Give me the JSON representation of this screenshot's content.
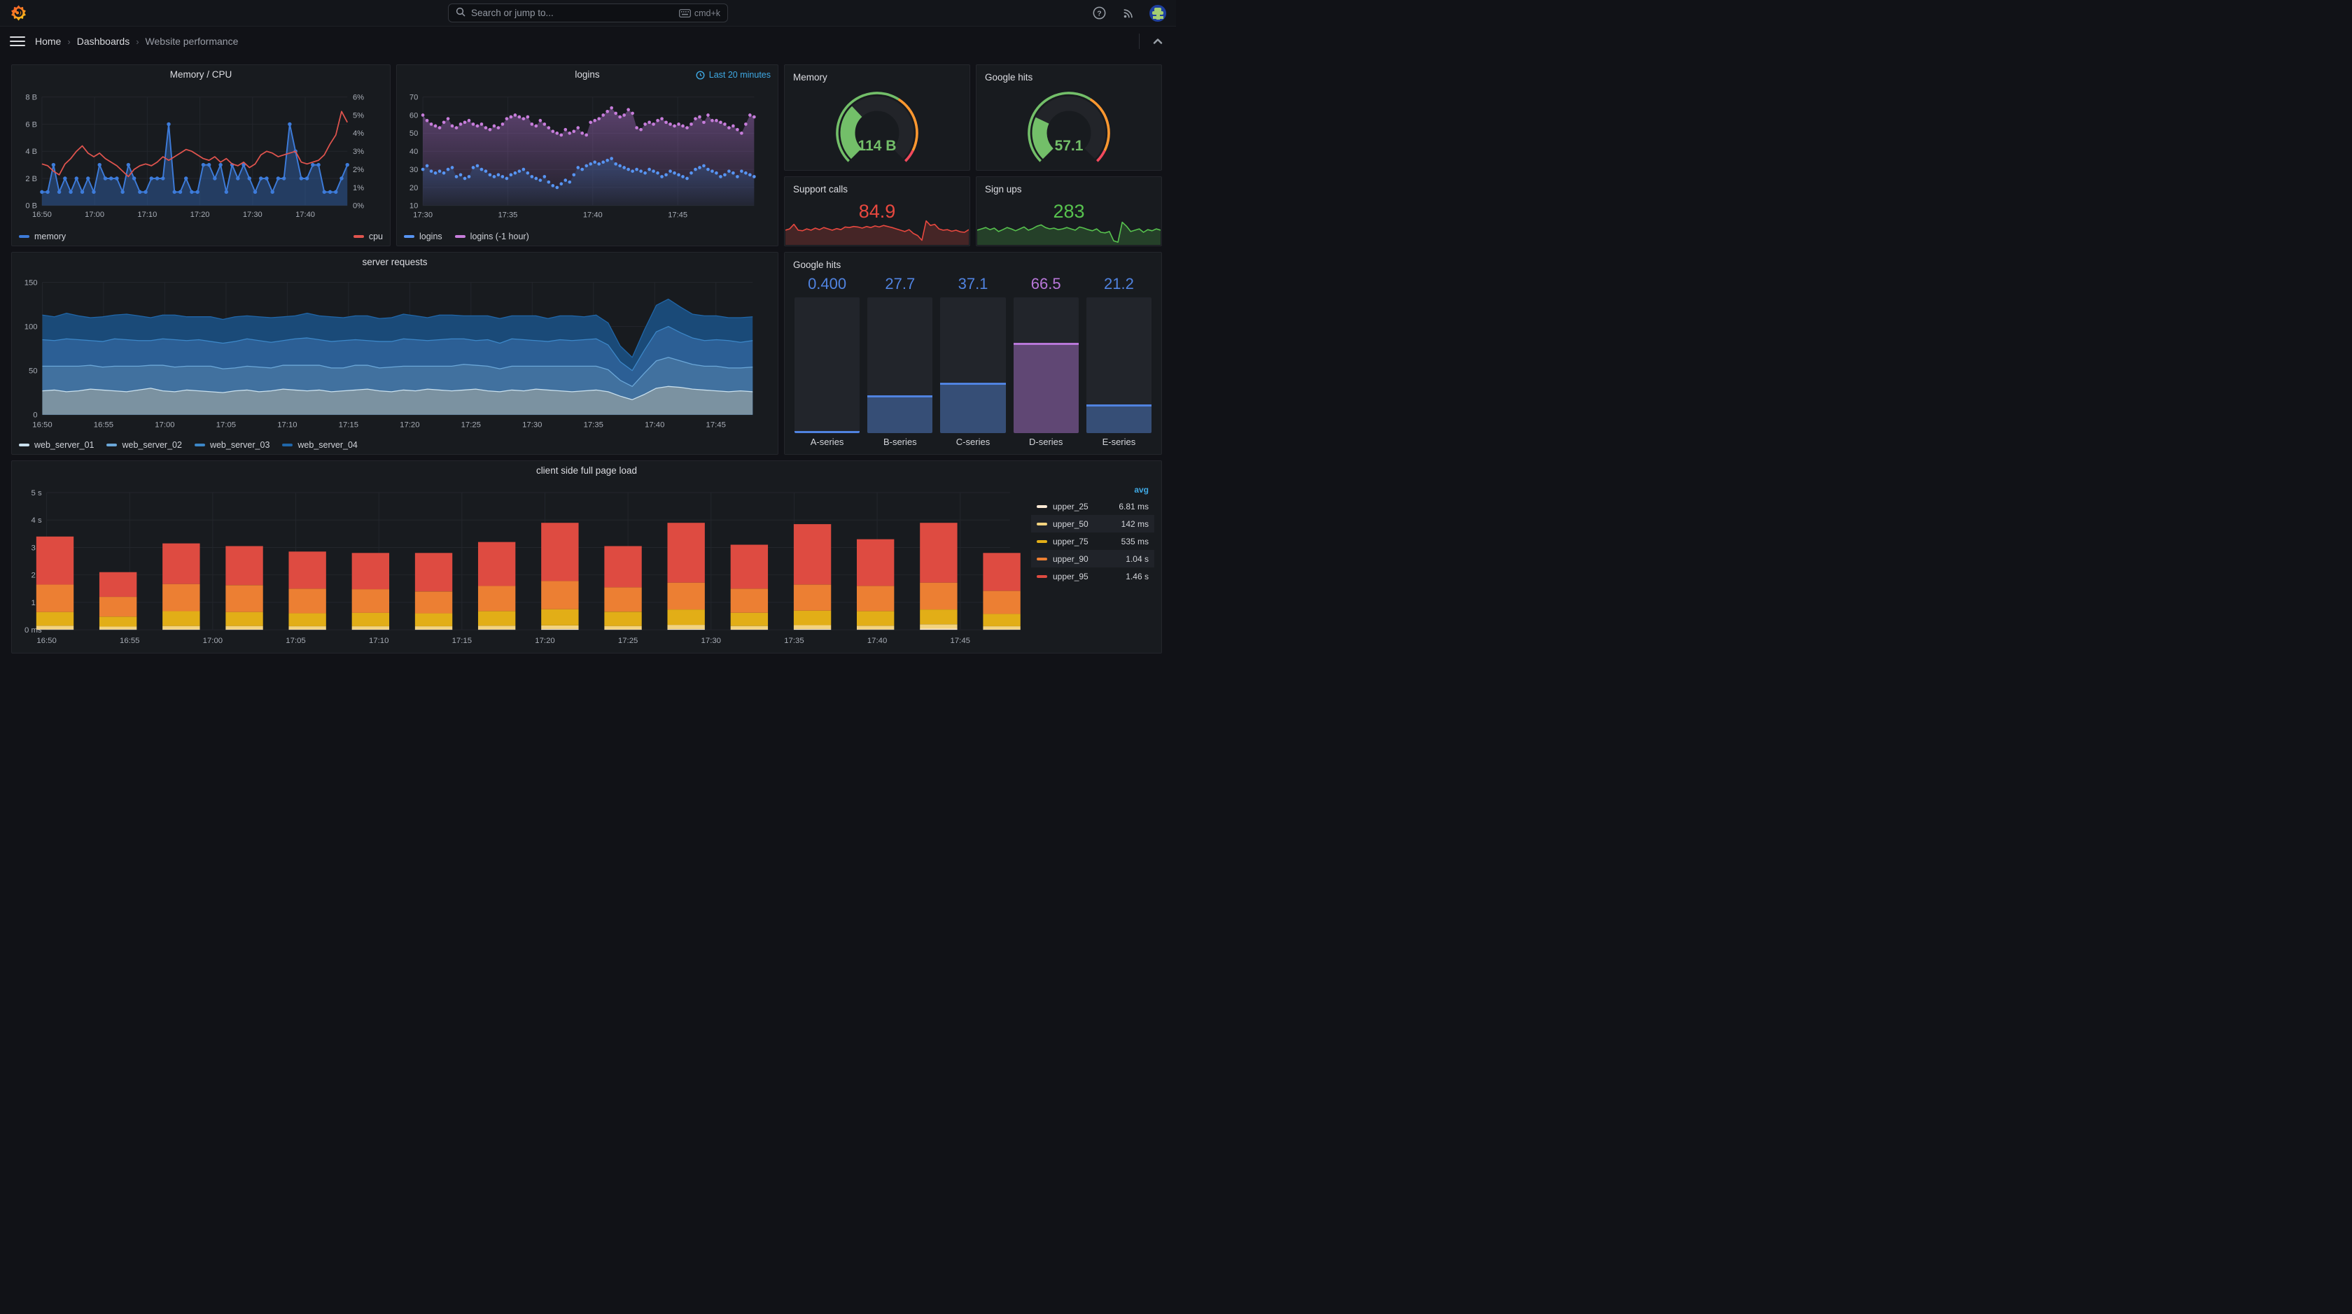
{
  "nav": {
    "search_placeholder": "Search or jump to...",
    "shortcut": "cmd+k"
  },
  "breadcrumb": {
    "items": [
      "Home",
      "Dashboards",
      "Website performance"
    ]
  },
  "chart_data": [
    {
      "type": "line",
      "title": "Memory / CPU",
      "xmax": 58,
      "x_ticks": [
        {
          "m": 0,
          "label": "16:50"
        },
        {
          "m": 10,
          "label": "17:00"
        },
        {
          "m": 20,
          "label": "17:10"
        },
        {
          "m": 30,
          "label": "17:20"
        },
        {
          "m": 40,
          "label": "17:30"
        },
        {
          "m": 50,
          "label": "17:40"
        }
      ],
      "y_left": {
        "ticks": [
          "0 B",
          "2 B",
          "4 B",
          "6 B",
          "8 B"
        ],
        "max": 8
      },
      "y_right": {
        "ticks": [
          "0%",
          "1%",
          "2%",
          "3%",
          "4%",
          "5%",
          "6%"
        ],
        "max": 6
      },
      "series": [
        {
          "name": "memory",
          "color": "#3d7bd9",
          "axis": "left",
          "values": [
            1,
            1,
            3,
            1,
            2,
            1,
            2,
            1,
            2,
            1,
            3,
            2,
            2,
            2,
            1,
            3,
            2,
            1,
            1,
            2,
            2,
            2,
            6,
            1,
            1,
            2,
            1,
            1,
            3,
            3,
            2,
            3,
            1,
            3,
            2,
            3,
            2,
            1,
            2,
            2,
            1,
            2,
            2,
            6,
            4,
            2,
            2,
            3,
            3,
            1,
            1,
            1,
            2,
            3
          ]
        },
        {
          "name": "cpu",
          "color": "#e0544e",
          "axis": "right",
          "values": [
            2.3,
            2.2,
            1.9,
            1.7,
            2.3,
            2.6,
            3.0,
            3.3,
            2.9,
            2.7,
            2.9,
            2.6,
            2.4,
            2.2,
            1.9,
            1.6,
            2.0,
            2.2,
            2.3,
            2.2,
            2.4,
            2.7,
            2.5,
            2.7,
            2.9,
            3.1,
            3.0,
            2.8,
            2.6,
            2.5,
            2.7,
            2.4,
            2.6,
            2.3,
            2.2,
            2.4,
            2.1,
            2.3,
            2.8,
            3.0,
            2.9,
            2.7,
            2.8,
            2.9,
            3.0,
            2.4,
            2.3,
            2.4,
            2.5,
            2.8,
            3.4,
            3.9,
            5.2,
            4.6
          ]
        }
      ]
    },
    {
      "type": "scatter-area",
      "title": "logins",
      "time_range": "Last 20 minutes",
      "xmax": 19.5,
      "x_ticks": [
        {
          "m": 0,
          "label": "17:30"
        },
        {
          "m": 5,
          "label": "17:35"
        },
        {
          "m": 10,
          "label": "17:40"
        },
        {
          "m": 15,
          "label": "17:45"
        }
      ],
      "y": {
        "min": 10,
        "max": 70,
        "ticks": [
          "10",
          "20",
          "30",
          "40",
          "50",
          "60",
          "70"
        ]
      },
      "series": [
        {
          "name": "logins",
          "color": "#5794f2",
          "values": [
            30,
            32,
            29,
            28,
            29,
            28,
            30,
            31,
            26,
            27,
            25,
            26,
            31,
            32,
            30,
            29,
            27,
            26,
            27,
            26,
            25,
            27,
            28,
            29,
            30,
            28,
            26,
            25,
            24,
            26,
            23,
            21,
            20,
            22,
            24,
            23,
            27,
            31,
            30,
            32,
            33,
            34,
            33,
            34,
            35,
            36,
            33,
            32,
            31,
            30,
            29,
            30,
            29,
            28,
            30,
            29,
            28,
            26,
            27,
            29,
            28,
            27,
            26,
            25,
            28,
            30,
            31,
            32,
            30,
            29,
            28,
            26,
            27,
            29,
            28,
            26,
            29,
            28,
            27,
            26
          ]
        },
        {
          "name": "logins (-1 hour)",
          "color": "#c77ddb",
          "values": [
            60,
            57,
            55,
            54,
            53,
            56,
            58,
            54,
            53,
            55,
            56,
            57,
            55,
            54,
            55,
            53,
            52,
            54,
            53,
            55,
            58,
            59,
            60,
            59,
            58,
            59,
            55,
            54,
            57,
            55,
            53,
            51,
            50,
            49,
            52,
            50,
            51,
            53,
            50,
            49,
            56,
            57,
            58,
            60,
            62,
            64,
            61,
            59,
            60,
            63,
            61,
            53,
            52,
            55,
            56,
            55,
            57,
            58,
            56,
            55,
            54,
            55,
            54,
            53,
            55,
            58,
            59,
            56,
            60,
            57,
            57,
            56,
            55,
            53,
            54,
            52,
            50,
            55,
            60,
            59
          ]
        }
      ]
    },
    {
      "type": "gauge",
      "title": "Memory",
      "value": "114 B",
      "fraction": 0.34,
      "color": "#73bf69",
      "thresholds": [
        {
          "to": 0.62,
          "color": "#73bf69"
        },
        {
          "to": 0.93,
          "color": "#ff9830"
        },
        {
          "to": 1,
          "color": "#f2495c"
        }
      ]
    },
    {
      "type": "gauge",
      "title": "Google hits",
      "value": "57.1",
      "fraction": 0.26,
      "color": "#73bf69",
      "thresholds": [
        {
          "to": 0.62,
          "color": "#73bf69"
        },
        {
          "to": 0.93,
          "color": "#ff9830"
        },
        {
          "to": 1,
          "color": "#f2495c"
        }
      ]
    },
    {
      "type": "stat",
      "title": "Support calls",
      "value": "84.9",
      "color": "#e8483f",
      "spark": [
        0.5,
        0.55,
        0.72,
        0.5,
        0.48,
        0.55,
        0.5,
        0.58,
        0.52,
        0.6,
        0.55,
        0.5,
        0.56,
        0.52,
        0.62,
        0.6,
        0.64,
        0.62,
        0.58,
        0.64,
        0.6,
        0.66,
        0.62,
        0.68,
        0.64,
        0.6,
        0.55,
        0.5,
        0.45,
        0.52,
        0.38,
        0.3,
        0.12,
        0.85,
        0.68,
        0.72,
        0.55,
        0.5,
        0.52,
        0.46,
        0.5,
        0.44,
        0.42,
        0.52
      ]
    },
    {
      "type": "stat",
      "title": "Sign ups",
      "value": "283",
      "color": "#57c24e",
      "spark": [
        0.5,
        0.55,
        0.6,
        0.52,
        0.58,
        0.45,
        0.52,
        0.6,
        0.55,
        0.48,
        0.55,
        0.62,
        0.5,
        0.56,
        0.65,
        0.7,
        0.6,
        0.55,
        0.58,
        0.52,
        0.55,
        0.6,
        0.55,
        0.5,
        0.62,
        0.58,
        0.52,
        0.48,
        0.55,
        0.42,
        0.4,
        0.45,
        0.1,
        0.05,
        0.8,
        0.65,
        0.45,
        0.5,
        0.55,
        0.42,
        0.52,
        0.48,
        0.55,
        0.5
      ]
    },
    {
      "type": "area-stacked",
      "title": "server requests",
      "xmax": 58,
      "x_ticks": [
        {
          "m": 0,
          "label": "16:50"
        },
        {
          "m": 5,
          "label": "16:55"
        },
        {
          "m": 10,
          "label": "17:00"
        },
        {
          "m": 15,
          "label": "17:05"
        },
        {
          "m": 20,
          "label": "17:10"
        },
        {
          "m": 25,
          "label": "17:15"
        },
        {
          "m": 30,
          "label": "17:20"
        },
        {
          "m": 35,
          "label": "17:25"
        },
        {
          "m": 40,
          "label": "17:30"
        },
        {
          "m": 45,
          "label": "17:35"
        },
        {
          "m": 50,
          "label": "17:40"
        },
        {
          "m": 55,
          "label": "17:45"
        }
      ],
      "y": {
        "min": 0,
        "max": 150,
        "ticks": [
          "0",
          "50",
          "100",
          "150"
        ]
      },
      "series": [
        {
          "name": "web_server_01",
          "color": "#c9e0ee",
          "fill": "#7b92a1",
          "values": [
            27,
            28,
            26,
            27,
            29,
            28,
            27,
            26,
            28,
            30,
            27,
            26,
            28,
            27,
            26,
            25,
            27,
            28,
            26,
            27,
            29,
            28,
            27,
            28,
            26,
            27,
            28,
            29,
            27,
            26,
            28,
            27,
            29,
            28,
            27,
            28,
            29,
            27,
            26,
            28,
            27,
            29,
            28,
            27,
            26,
            27,
            28,
            26,
            21,
            17,
            23,
            30,
            32,
            31,
            29,
            28,
            27,
            26,
            27,
            26
          ]
        },
        {
          "name": "web_server_02",
          "color": "#6ba7d8",
          "fill": "#41719f",
          "values": [
            28,
            27,
            29,
            28,
            27,
            26,
            28,
            29,
            27,
            26,
            29,
            28,
            27,
            28,
            29,
            27,
            26,
            27,
            28,
            26,
            27,
            28,
            29,
            28,
            27,
            26,
            28,
            27,
            26,
            28,
            27,
            28,
            26,
            27,
            28,
            29,
            27,
            28,
            26,
            27,
            28,
            26,
            27,
            28,
            29,
            28,
            27,
            25,
            18,
            15,
            24,
            31,
            33,
            30,
            28,
            27,
            28,
            27,
            26,
            28
          ]
        },
        {
          "name": "web_server_03",
          "color": "#3c87c8",
          "fill": "#2c5f95",
          "values": [
            30,
            29,
            31,
            30,
            28,
            29,
            31,
            30,
            29,
            28,
            30,
            31,
            29,
            30,
            28,
            29,
            30,
            31,
            30,
            29,
            28,
            30,
            31,
            29,
            30,
            31,
            29,
            28,
            30,
            29,
            31,
            30,
            29,
            30,
            31,
            29,
            28,
            30,
            29,
            31,
            30,
            29,
            28,
            30,
            29,
            30,
            31,
            28,
            21,
            18,
            26,
            33,
            35,
            32,
            30,
            29,
            30,
            31,
            29,
            30
          ]
        },
        {
          "name": "web_server_04",
          "color": "#2066a8",
          "fill": "#1a4a78",
          "values": [
            28,
            27,
            29,
            27,
            26,
            28,
            27,
            29,
            28,
            26,
            27,
            28,
            27,
            26,
            28,
            27,
            28,
            26,
            27,
            28,
            27,
            26,
            28,
            27,
            28,
            26,
            27,
            28,
            26,
            27,
            28,
            27,
            26,
            28,
            27,
            26,
            28,
            27,
            28,
            26,
            27,
            28,
            26,
            27,
            28,
            26,
            27,
            25,
            18,
            15,
            23,
            30,
            31,
            29,
            27,
            28,
            27,
            26,
            28,
            27
          ]
        }
      ]
    },
    {
      "type": "bargauge",
      "title": "Google hits",
      "max": 100,
      "bars": [
        {
          "label": "A-series",
          "value": "0.400",
          "v": 0.4,
          "color": "#5083e0",
          "fill": "rgba(87,148,242,0.38)"
        },
        {
          "label": "B-series",
          "value": "27.7",
          "v": 27.7,
          "color": "#5083e0",
          "fill": "rgba(87,148,242,0.38)"
        },
        {
          "label": "C-series",
          "value": "37.1",
          "v": 37.1,
          "color": "#5083e0",
          "fill": "rgba(87,148,242,0.38)"
        },
        {
          "label": "D-series",
          "value": "66.5",
          "v": 66.5,
          "color": "#b877d9",
          "fill": "rgba(184,119,217,0.42)"
        },
        {
          "label": "E-series",
          "value": "21.2",
          "v": 21.2,
          "color": "#5083e0",
          "fill": "rgba(87,148,242,0.38)"
        }
      ]
    },
    {
      "type": "bar-stacked",
      "title": "client side full page load",
      "xmax": 58,
      "x_ticks": [
        {
          "m": 0,
          "label": "16:50"
        },
        {
          "m": 5,
          "label": "16:55"
        },
        {
          "m": 10,
          "label": "17:00"
        },
        {
          "m": 15,
          "label": "17:05"
        },
        {
          "m": 20,
          "label": "17:10"
        },
        {
          "m": 25,
          "label": "17:15"
        },
        {
          "m": 30,
          "label": "17:20"
        },
        {
          "m": 35,
          "label": "17:25"
        },
        {
          "m": 40,
          "label": "17:30"
        },
        {
          "m": 45,
          "label": "17:35"
        },
        {
          "m": 50,
          "label": "17:40"
        },
        {
          "m": 55,
          "label": "17:45"
        }
      ],
      "y": {
        "ticks": [
          "0 ms",
          "1 s",
          "2 s",
          "3 s",
          "4 s",
          "5 s"
        ],
        "max": 5
      },
      "legend_header": "avg",
      "series": [
        {
          "name": "upper_25",
          "color": "#fbe9d4",
          "avg": "6.81 ms"
        },
        {
          "name": "upper_50",
          "color": "#f3d37e",
          "avg": "142 ms"
        },
        {
          "name": "upper_75",
          "color": "#e2ae17",
          "avg": "535 ms"
        },
        {
          "name": "upper_90",
          "color": "#ec7f33",
          "avg": "1.04 s"
        },
        {
          "name": "upper_95",
          "color": "#de4b41",
          "avg": "1.46 s"
        }
      ],
      "bars_minutes": [
        0.5,
        4.3,
        8.1,
        11.9,
        15.7,
        19.5,
        23.3,
        27.1,
        30.9,
        34.7,
        38.5,
        42.3,
        46.1,
        49.9,
        53.7,
        57.5
      ],
      "stack_tops": [
        [
          0.02,
          0.15,
          0.65,
          1.65,
          3.4
        ],
        [
          0.02,
          0.12,
          0.48,
          1.2,
          2.1
        ],
        [
          0.02,
          0.14,
          0.68,
          1.67,
          3.15
        ],
        [
          0.02,
          0.14,
          0.65,
          1.63,
          3.05
        ],
        [
          0.02,
          0.13,
          0.6,
          1.5,
          2.85
        ],
        [
          0.02,
          0.13,
          0.62,
          1.48,
          2.8
        ],
        [
          0.02,
          0.13,
          0.6,
          1.4,
          2.8
        ],
        [
          0.02,
          0.15,
          0.68,
          1.6,
          3.2
        ],
        [
          0.03,
          0.16,
          0.75,
          1.78,
          3.9
        ],
        [
          0.02,
          0.14,
          0.66,
          1.55,
          3.05
        ],
        [
          0.03,
          0.18,
          0.74,
          1.72,
          3.9
        ],
        [
          0.02,
          0.14,
          0.62,
          1.5,
          3.1
        ],
        [
          0.03,
          0.17,
          0.7,
          1.65,
          3.85
        ],
        [
          0.02,
          0.15,
          0.68,
          1.6,
          3.3
        ],
        [
          0.04,
          0.2,
          0.74,
          1.72,
          3.9
        ],
        [
          0.02,
          0.13,
          0.58,
          1.42,
          2.8
        ]
      ]
    }
  ]
}
